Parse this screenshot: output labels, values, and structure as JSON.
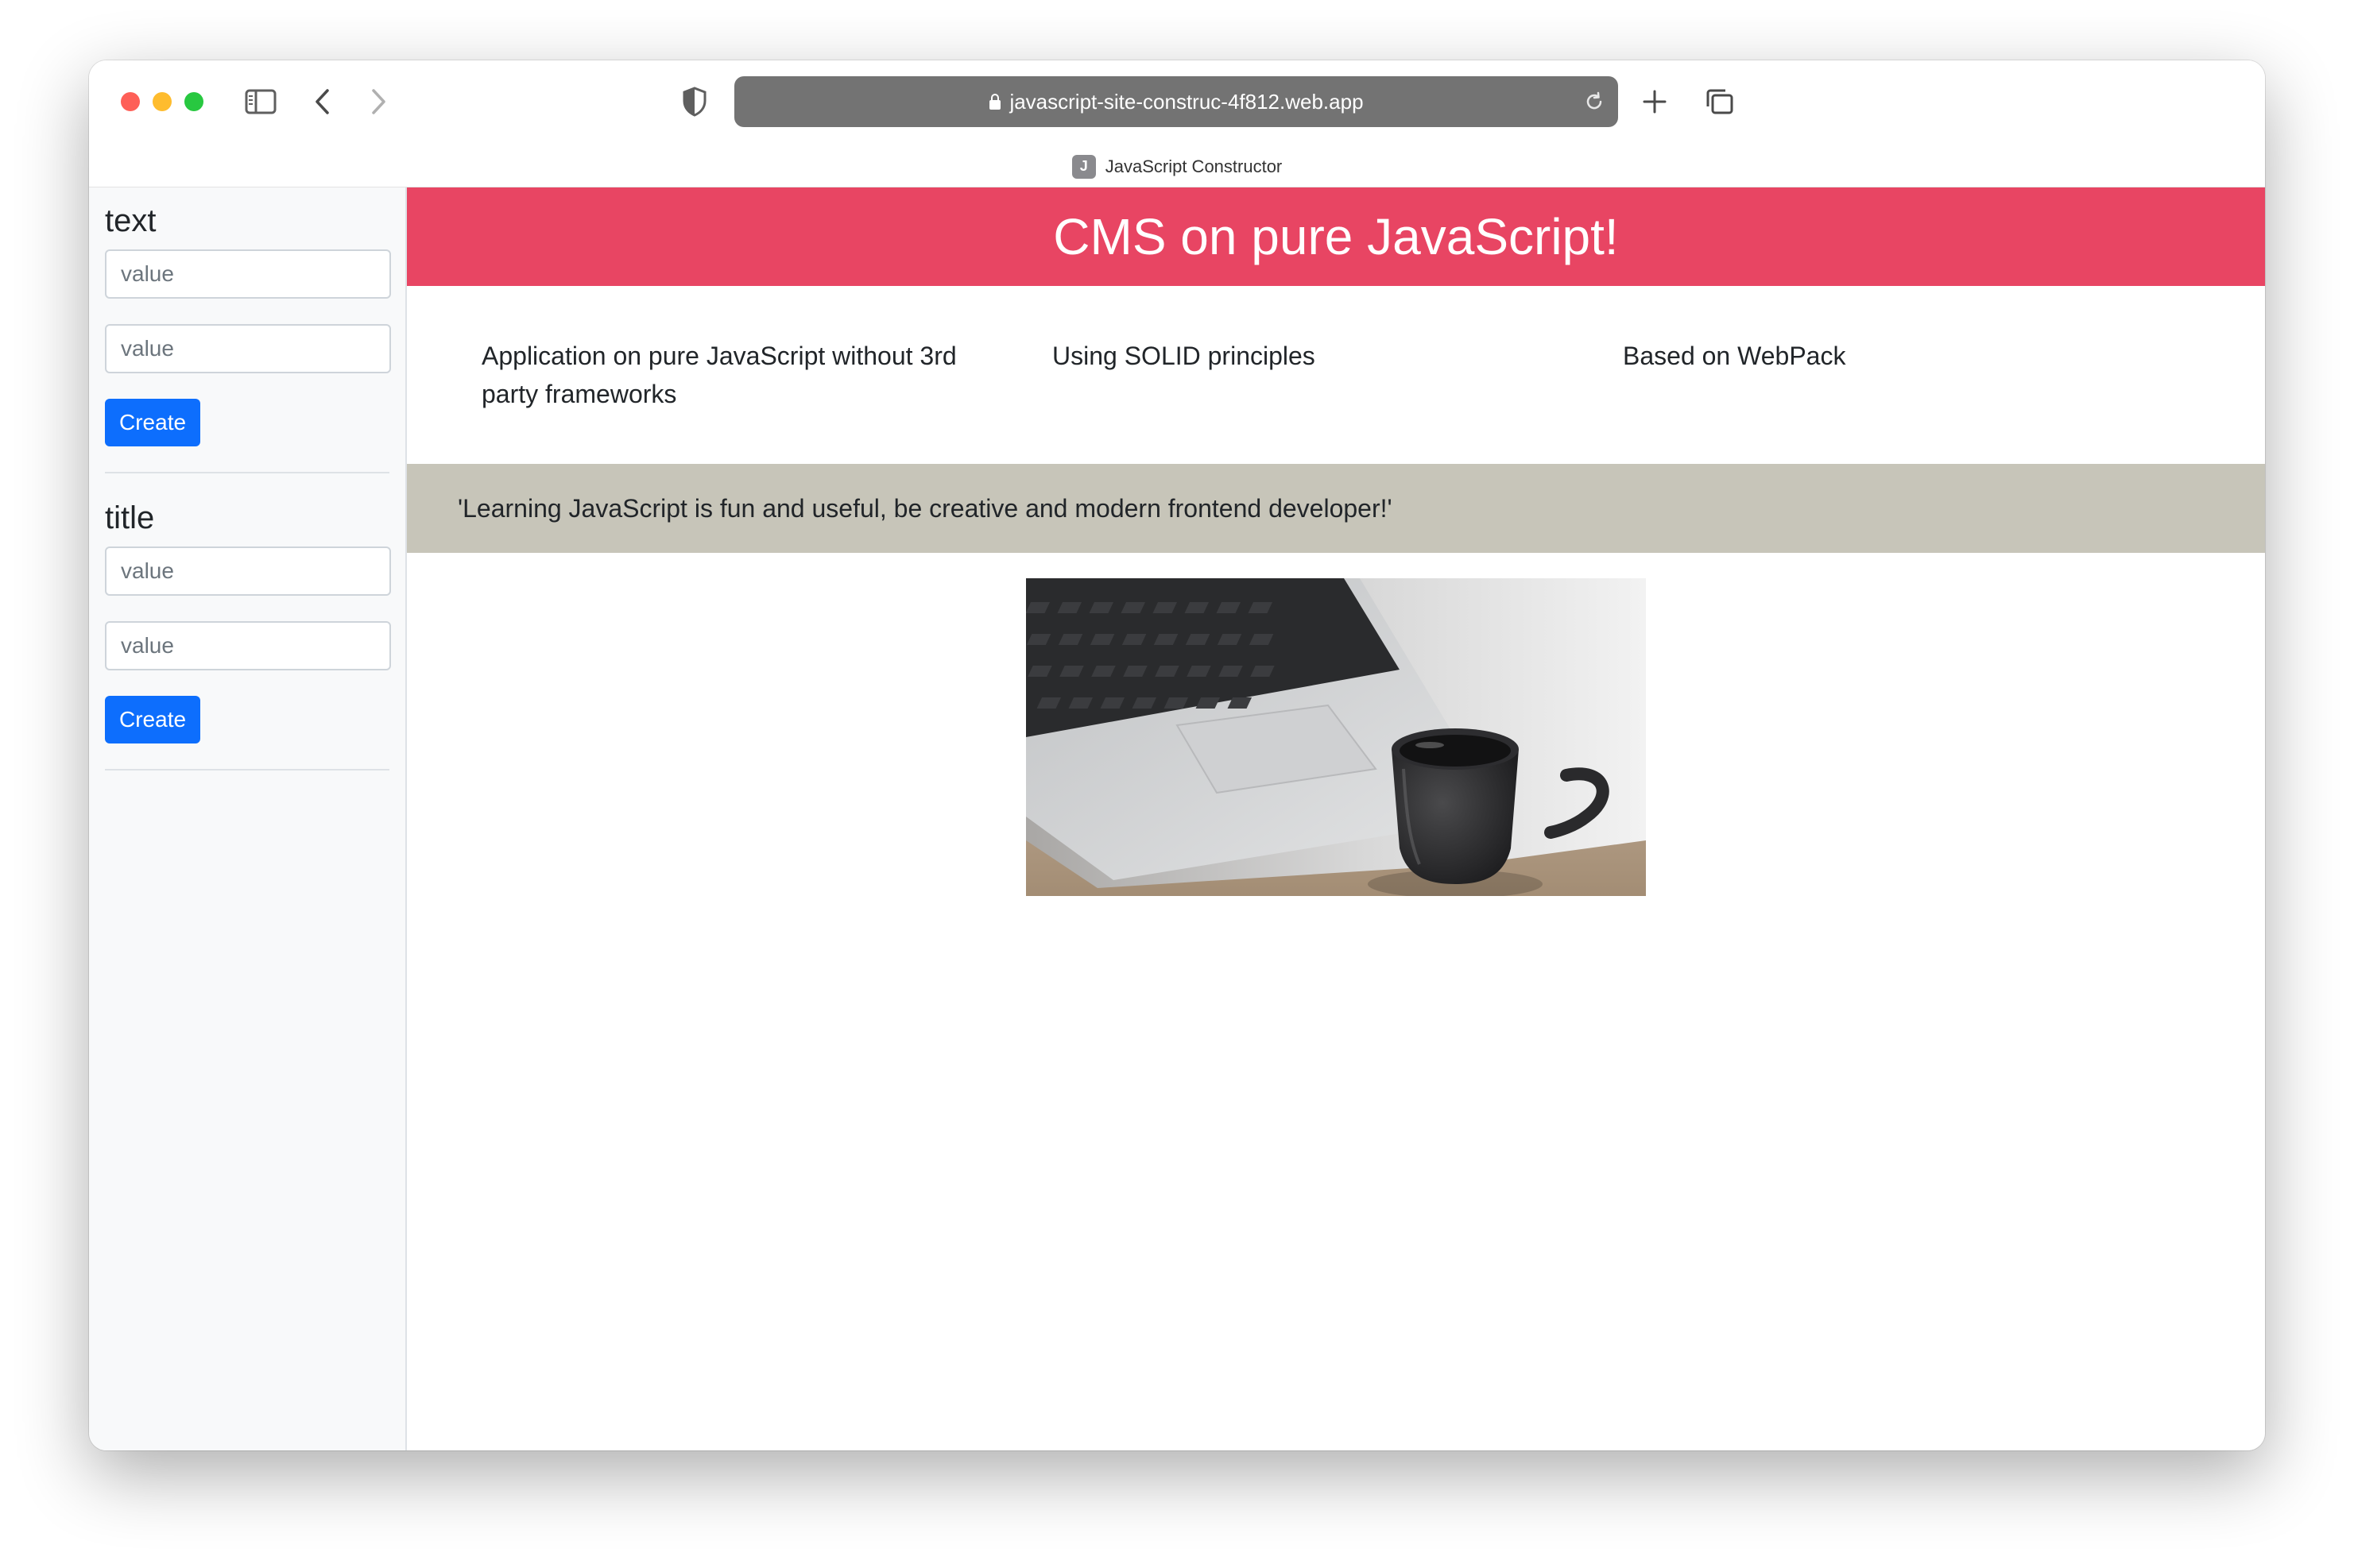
{
  "browser": {
    "url": "javascript-site-construc-4f812.web.app",
    "tab": {
      "favicon_letter": "J",
      "title": "JavaScript Constructor"
    },
    "icons": {
      "sidebar_toggle": "sidebar-toggle-icon",
      "back": "chevron-left-icon",
      "forward": "chevron-right-icon",
      "shield": "shield-icon",
      "lock": "lock-icon",
      "reload": "reload-icon",
      "new_tab": "plus-icon",
      "tab_overview": "tabs-icon"
    }
  },
  "sidebar": {
    "forms": [
      {
        "heading": "text",
        "inputs": [
          {
            "placeholder": "value",
            "value": ""
          },
          {
            "placeholder": "value",
            "value": ""
          }
        ],
        "button": "Create"
      },
      {
        "heading": "title",
        "inputs": [
          {
            "placeholder": "value",
            "value": ""
          },
          {
            "placeholder": "value",
            "value": ""
          }
        ],
        "button": "Create"
      }
    ]
  },
  "main": {
    "hero_title": "CMS on pure JavaScript!",
    "columns": [
      "Application on pure JavaScript without 3rd party frameworks",
      "Using SOLID principles",
      "Based on WebPack"
    ],
    "quote": "'Learning JavaScript is fun and useful, be creative and modern frontend developer!'",
    "image": {
      "subject": "laptop-and-coffee-cup-photo"
    }
  },
  "colors": {
    "hero_bg": "#e84563",
    "quote_bg": "#c7c5b9",
    "button_bg": "#0d6efd",
    "url_bar_bg": "#737373",
    "sidebar_bg": "#f8f9fa"
  }
}
